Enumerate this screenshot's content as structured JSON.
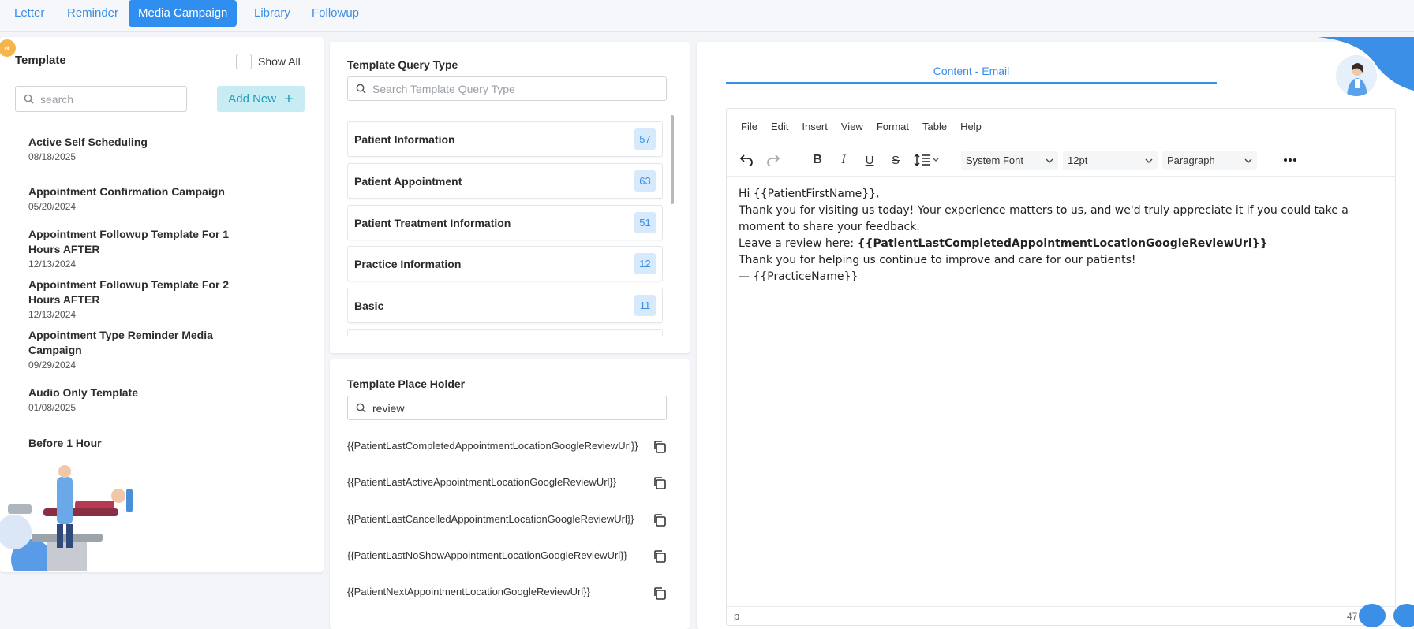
{
  "tabs": [
    {
      "label": "Letter"
    },
    {
      "label": "Reminder"
    },
    {
      "label": "Media Campaign",
      "active": true
    },
    {
      "label": "Library"
    },
    {
      "label": "Followup"
    }
  ],
  "left": {
    "collapse_glyph": "«",
    "title": "Template",
    "show_all_label": "Show All",
    "search_placeholder": "search",
    "add_new_label": "Add New",
    "templates": [
      {
        "name": "Active Self Scheduling",
        "date": "08/18/2025"
      },
      {
        "name": "Appointment Confirmation Campaign",
        "date": "05/20/2024"
      },
      {
        "name": "Appointment Followup Template For 1 Hours AFTER",
        "date": "12/13/2024"
      },
      {
        "name": "Appointment Followup Template For 2 Hours AFTER",
        "date": "12/13/2024"
      },
      {
        "name": "Appointment Type Reminder Media Campaign",
        "date": "09/29/2024"
      },
      {
        "name": "Audio Only Template",
        "date": "01/08/2025"
      },
      {
        "name": "Before 1 Hour",
        "date": ""
      }
    ]
  },
  "query": {
    "title": "Template Query Type",
    "search_placeholder": "Search Template Query Type",
    "items": [
      {
        "label": "Patient Information",
        "count": "57"
      },
      {
        "label": "Patient Appointment",
        "count": "63"
      },
      {
        "label": "Patient Treatment Information",
        "count": "51"
      },
      {
        "label": "Practice Information",
        "count": "12"
      },
      {
        "label": "Basic",
        "count": "11"
      },
      {
        "label": "",
        "count": ""
      }
    ]
  },
  "placeholder": {
    "title": "Template Place Holder",
    "search_value": "review",
    "items": [
      "{{PatientLastCompletedAppointmentLocationGoogleReviewUrl}}",
      "{{PatientLastActiveAppointmentLocationGoogleReviewUrl}}",
      "{{PatientLastCancelledAppointmentLocationGoogleReviewUrl}}",
      "{{PatientLastNoShowAppointmentLocationGoogleReviewUrl}}",
      "{{PatientNextAppointmentLocationGoogleReviewUrl}}"
    ]
  },
  "editor": {
    "content_tab": "Content - Email",
    "menu": [
      "File",
      "Edit",
      "Insert",
      "View",
      "Format",
      "Table",
      "Help"
    ],
    "font_family": "System Font",
    "font_size": "12pt",
    "block_format": "Paragraph",
    "body": {
      "line1": "Hi {{PatientFirstName}},",
      "line2": "Thank you for visiting us today! Your experience matters to us, and we'd truly appreciate it if you could take a moment to share your feedback.",
      "line3_prefix": "Leave a review here: ",
      "line3_bold": "{{PatientLastCompletedAppointmentLocationGoogleReviewUrl}}",
      "line4": "Thank you for helping us continue to improve and care for our patients!",
      "line5": "— {{PracticeName}}"
    },
    "status_path": "p",
    "word_count": "47"
  },
  "colors": {
    "accent": "#2f8ef0",
    "add_new_bg": "#c7ecf3",
    "count_badge_bg": "#d7eafc"
  }
}
